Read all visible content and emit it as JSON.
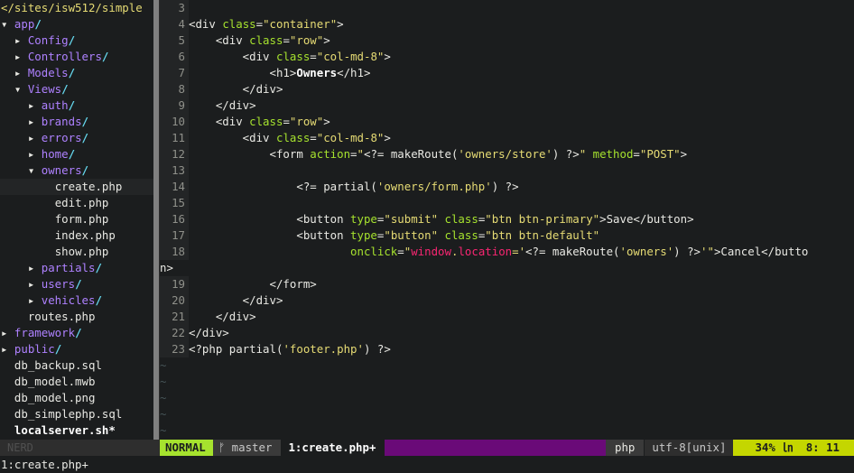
{
  "tree": {
    "header": "</sites/isw512/simple",
    "status": "NERD",
    "rows": [
      {
        "indent": "",
        "arrow": "▾ ",
        "name": "app",
        "kind": "dir"
      },
      {
        "indent": "  ",
        "arrow": "▸ ",
        "name": "Config",
        "kind": "dir"
      },
      {
        "indent": "  ",
        "arrow": "▸ ",
        "name": "Controllers",
        "kind": "dir"
      },
      {
        "indent": "  ",
        "arrow": "▸ ",
        "name": "Models",
        "kind": "dir"
      },
      {
        "indent": "  ",
        "arrow": "▾ ",
        "name": "Views",
        "kind": "dir"
      },
      {
        "indent": "    ",
        "arrow": "▸ ",
        "name": "auth",
        "kind": "dir"
      },
      {
        "indent": "    ",
        "arrow": "▸ ",
        "name": "brands",
        "kind": "dir"
      },
      {
        "indent": "    ",
        "arrow": "▸ ",
        "name": "errors",
        "kind": "dir"
      },
      {
        "indent": "    ",
        "arrow": "▸ ",
        "name": "home",
        "kind": "dir"
      },
      {
        "indent": "    ",
        "arrow": "▾ ",
        "name": "owners",
        "kind": "dir"
      },
      {
        "indent": "        ",
        "arrow": "",
        "name": "create.php",
        "kind": "file",
        "selected": true
      },
      {
        "indent": "        ",
        "arrow": "",
        "name": "edit.php",
        "kind": "file"
      },
      {
        "indent": "        ",
        "arrow": "",
        "name": "form.php",
        "kind": "file"
      },
      {
        "indent": "        ",
        "arrow": "",
        "name": "index.php",
        "kind": "file"
      },
      {
        "indent": "        ",
        "arrow": "",
        "name": "show.php",
        "kind": "file"
      },
      {
        "indent": "    ",
        "arrow": "▸ ",
        "name": "partials",
        "kind": "dir"
      },
      {
        "indent": "    ",
        "arrow": "▸ ",
        "name": "users",
        "kind": "dir"
      },
      {
        "indent": "    ",
        "arrow": "▸ ",
        "name": "vehicles",
        "kind": "dir"
      },
      {
        "indent": "    ",
        "arrow": "",
        "name": "routes.php",
        "kind": "file"
      },
      {
        "indent": "",
        "arrow": "▸ ",
        "name": "framework",
        "kind": "dir"
      },
      {
        "indent": "",
        "arrow": "▸ ",
        "name": "public",
        "kind": "dir"
      },
      {
        "indent": "  ",
        "arrow": "",
        "name": "db_backup.sql",
        "kind": "file"
      },
      {
        "indent": "  ",
        "arrow": "",
        "name": "db_model.mwb",
        "kind": "file"
      },
      {
        "indent": "  ",
        "arrow": "",
        "name": "db_model.png",
        "kind": "file"
      },
      {
        "indent": "  ",
        "arrow": "",
        "name": "db_simplephp.sql",
        "kind": "file"
      },
      {
        "indent": "  ",
        "arrow": "",
        "name": "localserver.sh*",
        "kind": "exec"
      }
    ]
  },
  "editor": {
    "lines": [
      {
        "n": "3",
        "tokens": []
      },
      {
        "n": "4",
        "tokens": [
          [
            "wht",
            "<div "
          ],
          [
            "grn",
            "class"
          ],
          [
            "wht",
            "="
          ],
          [
            "yel",
            "\"container\""
          ],
          [
            "wht",
            ">"
          ]
        ]
      },
      {
        "n": "5",
        "tokens": [
          [
            "wht",
            "    <div "
          ],
          [
            "grn",
            "class"
          ],
          [
            "wht",
            "="
          ],
          [
            "yel",
            "\"row\""
          ],
          [
            "wht",
            ">"
          ]
        ]
      },
      {
        "n": "6",
        "tokens": [
          [
            "wht",
            "        <div "
          ],
          [
            "grn",
            "class"
          ],
          [
            "wht",
            "="
          ],
          [
            "yel",
            "\"col-md-8\""
          ],
          [
            "wht",
            ">"
          ]
        ]
      },
      {
        "n": "7",
        "tokens": [
          [
            "wht",
            "            <h1>"
          ],
          [
            "bold",
            "Owners"
          ],
          [
            "wht",
            "</h1>"
          ]
        ]
      },
      {
        "n": "8",
        "tokens": [
          [
            "wht",
            "        </div>"
          ]
        ]
      },
      {
        "n": "9",
        "tokens": [
          [
            "wht",
            "    </div>"
          ]
        ]
      },
      {
        "n": "10",
        "tokens": [
          [
            "wht",
            "    <div "
          ],
          [
            "grn",
            "class"
          ],
          [
            "wht",
            "="
          ],
          [
            "yel",
            "\"row\""
          ],
          [
            "wht",
            ">"
          ]
        ]
      },
      {
        "n": "11",
        "tokens": [
          [
            "wht",
            "        <div "
          ],
          [
            "grn",
            "class"
          ],
          [
            "wht",
            "="
          ],
          [
            "yel",
            "\"col-md-8\""
          ],
          [
            "wht",
            ">"
          ]
        ]
      },
      {
        "n": "12",
        "tokens": [
          [
            "wht",
            "            <form "
          ],
          [
            "grn",
            "action"
          ],
          [
            "wht",
            "="
          ],
          [
            "yel",
            "\""
          ],
          [
            "wht",
            "<?= makeRoute("
          ],
          [
            "yel",
            "'owners/store'"
          ],
          [
            "wht",
            ") ?>"
          ],
          [
            "yel",
            "\""
          ],
          [
            "wht",
            " "
          ],
          [
            "grn",
            "method"
          ],
          [
            "wht",
            "="
          ],
          [
            "yel",
            "\"POST\""
          ],
          [
            "wht",
            ">"
          ]
        ]
      },
      {
        "n": "13",
        "tokens": []
      },
      {
        "n": "14",
        "tokens": [
          [
            "wht",
            "                <?= partial("
          ],
          [
            "yel",
            "'owners/form.php'"
          ],
          [
            "wht",
            ") ?>"
          ]
        ]
      },
      {
        "n": "15",
        "tokens": []
      },
      {
        "n": "16",
        "tokens": [
          [
            "wht",
            "                <button "
          ],
          [
            "grn",
            "type"
          ],
          [
            "wht",
            "="
          ],
          [
            "yel",
            "\"submit\""
          ],
          [
            "wht",
            " "
          ],
          [
            "grn",
            "class"
          ],
          [
            "wht",
            "="
          ],
          [
            "yel",
            "\"btn btn-primary\""
          ],
          [
            "wht",
            ">Save</button>"
          ]
        ]
      },
      {
        "n": "17",
        "tokens": [
          [
            "wht",
            "                <button "
          ],
          [
            "grn",
            "type"
          ],
          [
            "wht",
            "="
          ],
          [
            "yel",
            "\"button\""
          ],
          [
            "wht",
            " "
          ],
          [
            "grn",
            "class"
          ],
          [
            "wht",
            "="
          ],
          [
            "yel",
            "\"btn btn-default\""
          ]
        ]
      },
      {
        "n": "18",
        "tokens": [
          [
            "wht",
            "                        "
          ],
          [
            "grn",
            "onclick"
          ],
          [
            "wht",
            "="
          ],
          [
            "yel",
            "\""
          ],
          [
            "red",
            "window"
          ],
          [
            "yel",
            "."
          ],
          [
            "red",
            "location"
          ],
          [
            "yel",
            "='"
          ],
          [
            "wht",
            "<?= makeRoute("
          ],
          [
            "yel",
            "'owners'"
          ],
          [
            "wht",
            ") ?>"
          ],
          [
            "yel",
            "'\""
          ],
          [
            "wht",
            ">Cancel</butto"
          ]
        ]
      },
      {
        "n": "",
        "wrap": true,
        "tokens": [
          [
            "wht",
            "n>"
          ]
        ]
      },
      {
        "n": "19",
        "tokens": [
          [
            "wht",
            "            </form>"
          ]
        ]
      },
      {
        "n": "20",
        "tokens": [
          [
            "wht",
            "        </div>"
          ]
        ]
      },
      {
        "n": "21",
        "tokens": [
          [
            "wht",
            "    </div>"
          ]
        ]
      },
      {
        "n": "22",
        "tokens": [
          [
            "wht",
            "</div>"
          ]
        ]
      },
      {
        "n": "23",
        "tokens": [
          [
            "wht",
            "<?php partial("
          ],
          [
            "yel",
            "'footer.php'"
          ],
          [
            "wht",
            ") ?>"
          ]
        ]
      }
    ],
    "tildes": [
      "~",
      "~",
      "~",
      "~",
      "~"
    ]
  },
  "statusline": {
    "mode": "NORMAL",
    "branch_icon": "ᚠ",
    "branch": "master",
    "file": "1:create.php+",
    "filetype": "php",
    "encoding": "utf-8[unix]",
    "percent": "34%",
    "ln_icon": "㏑",
    "position": "8:  11"
  },
  "cmdline": "1:create.php+",
  "colors": {
    "bg": "#1b1d1e",
    "mode_bg": "#a6e22e",
    "fill_purple": "#6a0a78",
    "pos_bg": "#c4d600",
    "dir": "#ae81ff",
    "slash": "#66d9ef",
    "string": "#e6db74",
    "attr": "#a6e22e"
  }
}
